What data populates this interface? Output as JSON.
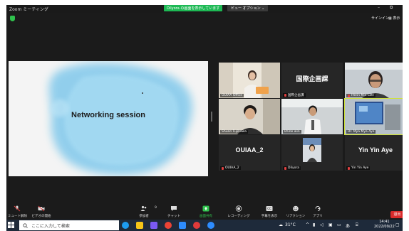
{
  "window": {
    "app_title": "Zoom ミーティング",
    "share_notice": "Dilyora の画面を表示しています",
    "view_options": "ビュー オプション ⌄",
    "minimize": "–",
    "restore": "⧉"
  },
  "topbar": {
    "sign_in": "サインイン",
    "view": "▦ 表示"
  },
  "shared_screen": {
    "title": "Networking session"
  },
  "participants": [
    {
      "name": "OUIAA Office",
      "mic_muted": false,
      "has_video": true
    },
    {
      "name": "国際企画課",
      "display_text": "国際企画課",
      "mic_muted": true,
      "has_video": false
    },
    {
      "name": "Htein Min Latt",
      "mic_muted": true,
      "has_video": true
    },
    {
      "name": "Shuan Fujikawa",
      "mic_muted": false,
      "has_video": true
    },
    {
      "name": "khine win",
      "mic_muted": false,
      "has_video": true
    },
    {
      "name": "Dr. Mya Mya Aye",
      "mic_muted": false,
      "has_video": true,
      "active_speaker": true
    },
    {
      "name": "OUIAA_2",
      "display_text": "OUIAA_2",
      "mic_muted": true,
      "has_video": false
    },
    {
      "name": "Dilyora",
      "mic_muted": true,
      "has_video": true
    },
    {
      "name": "Yin Yin Aye",
      "display_text": "Yin Yin Aye",
      "mic_muted": true,
      "has_video": false
    }
  ],
  "toolbar": {
    "mute": "ミュート解除",
    "video": "ビデオの開始",
    "participants": "参加者",
    "participants_count": "9",
    "chat": "チャット",
    "share": "画面共有",
    "record": "レコーディング",
    "captions": "字幕を表示",
    "reactions": "リアクション",
    "apps": "アプリ",
    "end": "退出"
  },
  "taskbar": {
    "search_placeholder": "ここに入力して検索",
    "weather": "31°C",
    "ime": "あ",
    "time": "14:41",
    "date": "2022/09/22"
  },
  "colors": {
    "share_pill": "#1db954",
    "active_speaker": "#cfe23a",
    "end_button": "#d92b2b",
    "muted_mic": "#e04040"
  }
}
